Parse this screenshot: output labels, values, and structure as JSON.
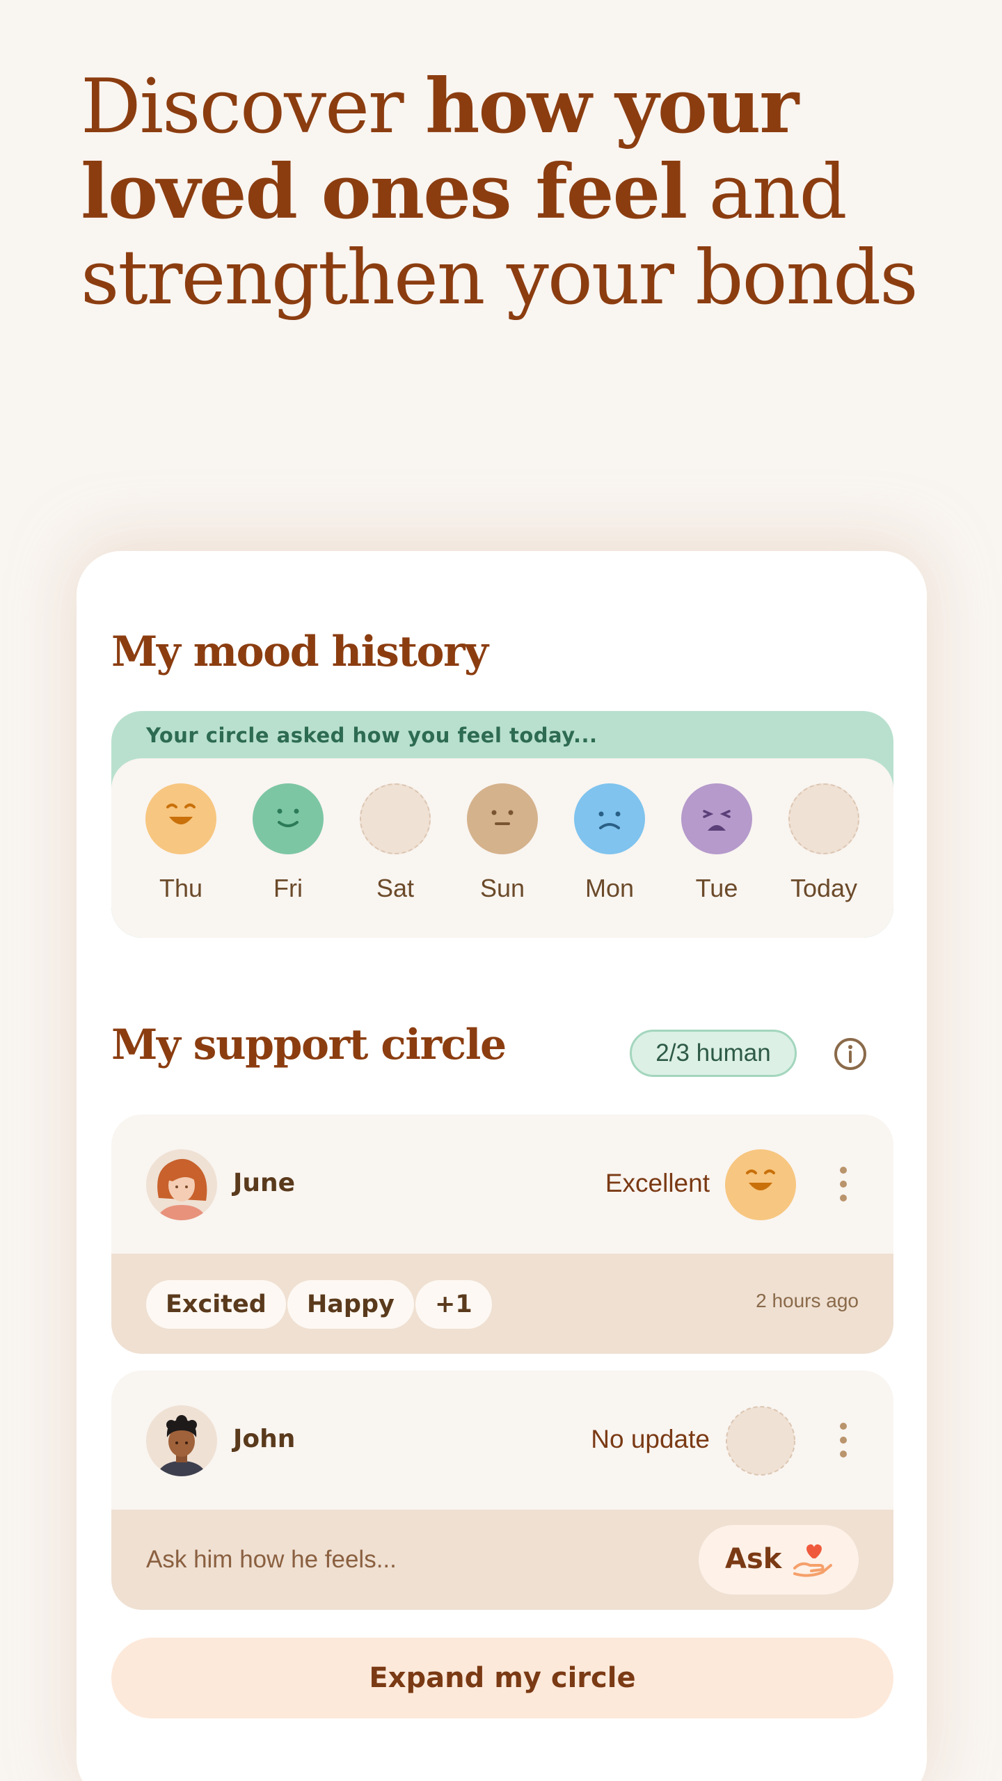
{
  "headline": {
    "part1": "Discover ",
    "part2": "how your loved ones feel",
    "part3": " and strengthen your bonds"
  },
  "mood_history": {
    "title": "My mood history",
    "banner": "Your circle asked how you feel today...",
    "days": [
      {
        "label": "Thu",
        "mood": "excellent",
        "color": "#f7c680"
      },
      {
        "label": "Fri",
        "mood": "good",
        "color": "#7dc6a4"
      },
      {
        "label": "Sat",
        "mood": "none",
        "color": "#efe1d4"
      },
      {
        "label": "Sun",
        "mood": "neutral",
        "color": "#d4b28c"
      },
      {
        "label": "Mon",
        "mood": "sad",
        "color": "#7fc3ee"
      },
      {
        "label": "Tue",
        "mood": "bad",
        "color": "#b59acb"
      },
      {
        "label": "Today",
        "mood": "none",
        "color": "#efe1d4"
      }
    ]
  },
  "support_circle": {
    "title": "My support circle",
    "badge": "2/3 human",
    "people": [
      {
        "name": "June",
        "status": "Excellent",
        "tags": [
          "Excited",
          "Happy",
          "+1"
        ],
        "time": "2 hours ago"
      },
      {
        "name": "John",
        "status": "No update",
        "ask_prompt": "Ask him how he feels...",
        "ask_label": "Ask"
      }
    ],
    "expand_label": "Expand my circle"
  },
  "colors": {
    "brand": "#8b3d10",
    "background": "#f9f5f1",
    "accent_green": "#b9e0ce",
    "button_peach": "#fde9da"
  }
}
